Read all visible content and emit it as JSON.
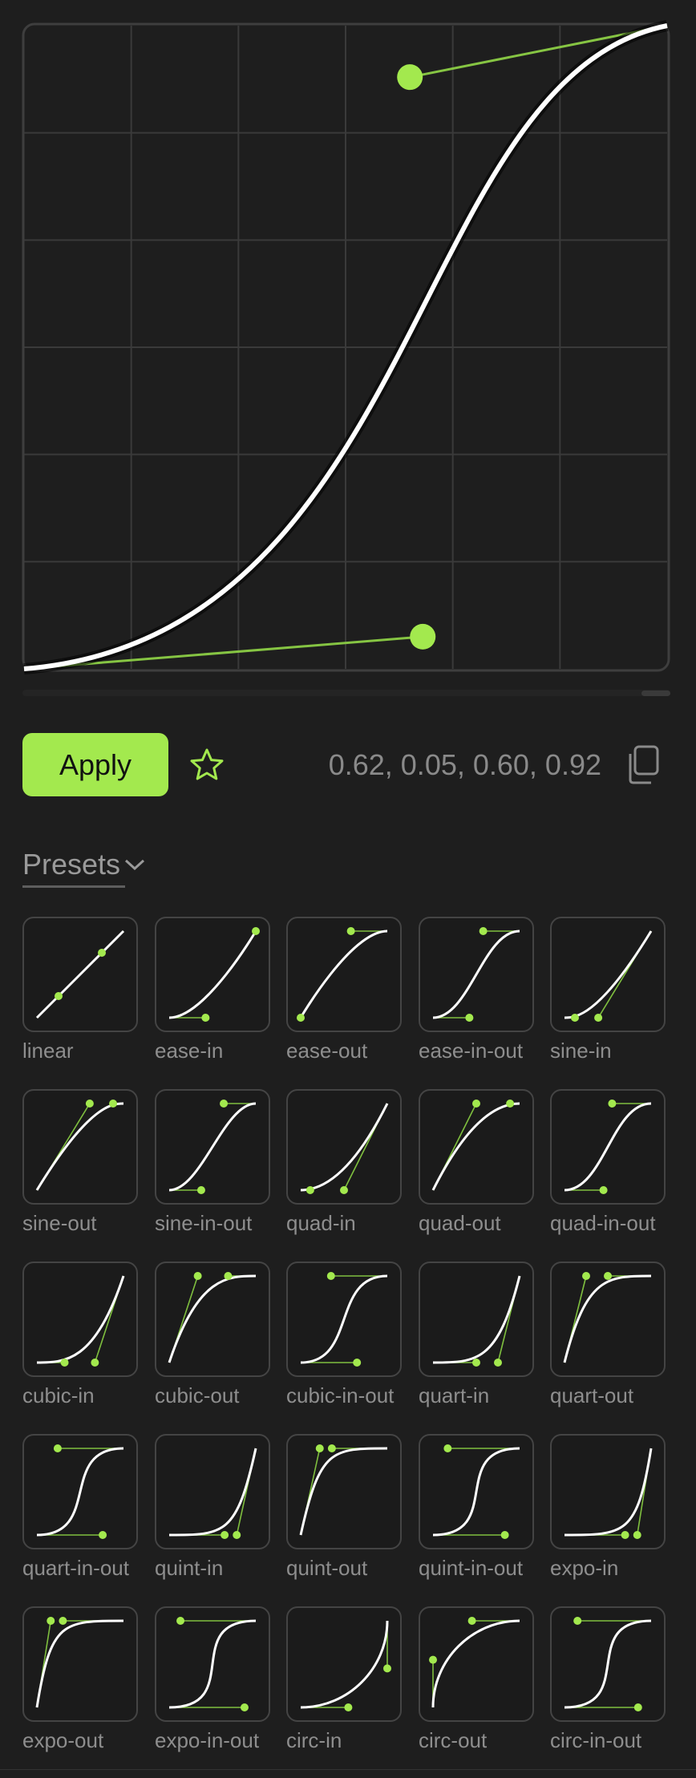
{
  "curve": {
    "x1": 0.62,
    "y1": 0.05,
    "x2": 0.6,
    "y2": 0.92
  },
  "values_text": "0.62, 0.05, 0.60, 0.92",
  "apply_label": "Apply",
  "presets_label": "Presets",
  "colors": {
    "accent": "#a3e94e",
    "background": "#1e1e1e",
    "grid": "#3a3a3a",
    "curve": "#ffffff"
  },
  "icons": {
    "favorite": "star-icon",
    "copy": "copy-icon",
    "presets_toggle": "chevron-down-icon"
  },
  "presets": [
    {
      "name": "linear",
      "p": [
        0.25,
        0.25,
        0.75,
        0.75
      ]
    },
    {
      "name": "ease-in",
      "p": [
        0.42,
        0,
        1,
        1
      ]
    },
    {
      "name": "ease-out",
      "p": [
        0,
        0,
        0.58,
        1
      ]
    },
    {
      "name": "ease-in-out",
      "p": [
        0.42,
        0,
        0.58,
        1
      ]
    },
    {
      "name": "sine-in",
      "p": [
        0.12,
        0,
        0.39,
        0
      ]
    },
    {
      "name": "sine-out",
      "p": [
        0.61,
        1,
        0.88,
        1
      ]
    },
    {
      "name": "sine-in-out",
      "p": [
        0.37,
        0,
        0.63,
        1
      ]
    },
    {
      "name": "quad-in",
      "p": [
        0.11,
        0,
        0.5,
        0
      ]
    },
    {
      "name": "quad-out",
      "p": [
        0.5,
        1,
        0.89,
        1
      ]
    },
    {
      "name": "quad-in-out",
      "p": [
        0.45,
        0,
        0.55,
        1
      ]
    },
    {
      "name": "cubic-in",
      "p": [
        0.32,
        0,
        0.67,
        0
      ]
    },
    {
      "name": "cubic-out",
      "p": [
        0.33,
        1,
        0.68,
        1
      ]
    },
    {
      "name": "cubic-in-out",
      "p": [
        0.65,
        0,
        0.35,
        1
      ]
    },
    {
      "name": "quart-in",
      "p": [
        0.5,
        0,
        0.75,
        0
      ]
    },
    {
      "name": "quart-out",
      "p": [
        0.25,
        1,
        0.5,
        1
      ]
    },
    {
      "name": "quart-in-out",
      "p": [
        0.76,
        0,
        0.24,
        1
      ]
    },
    {
      "name": "quint-in",
      "p": [
        0.64,
        0,
        0.78,
        0
      ]
    },
    {
      "name": "quint-out",
      "p": [
        0.22,
        1,
        0.36,
        1
      ]
    },
    {
      "name": "quint-in-out",
      "p": [
        0.83,
        0,
        0.17,
        1
      ]
    },
    {
      "name": "expo-in",
      "p": [
        0.7,
        0,
        0.84,
        0
      ]
    },
    {
      "name": "expo-out",
      "p": [
        0.16,
        1,
        0.3,
        1
      ]
    },
    {
      "name": "expo-in-out",
      "p": [
        0.87,
        0,
        0.13,
        1
      ]
    },
    {
      "name": "circ-in",
      "p": [
        0.55,
        0,
        1,
        0.45
      ]
    },
    {
      "name": "circ-out",
      "p": [
        0,
        0.55,
        0.45,
        1
      ]
    },
    {
      "name": "circ-in-out",
      "p": [
        0.85,
        0,
        0.15,
        1
      ]
    }
  ]
}
